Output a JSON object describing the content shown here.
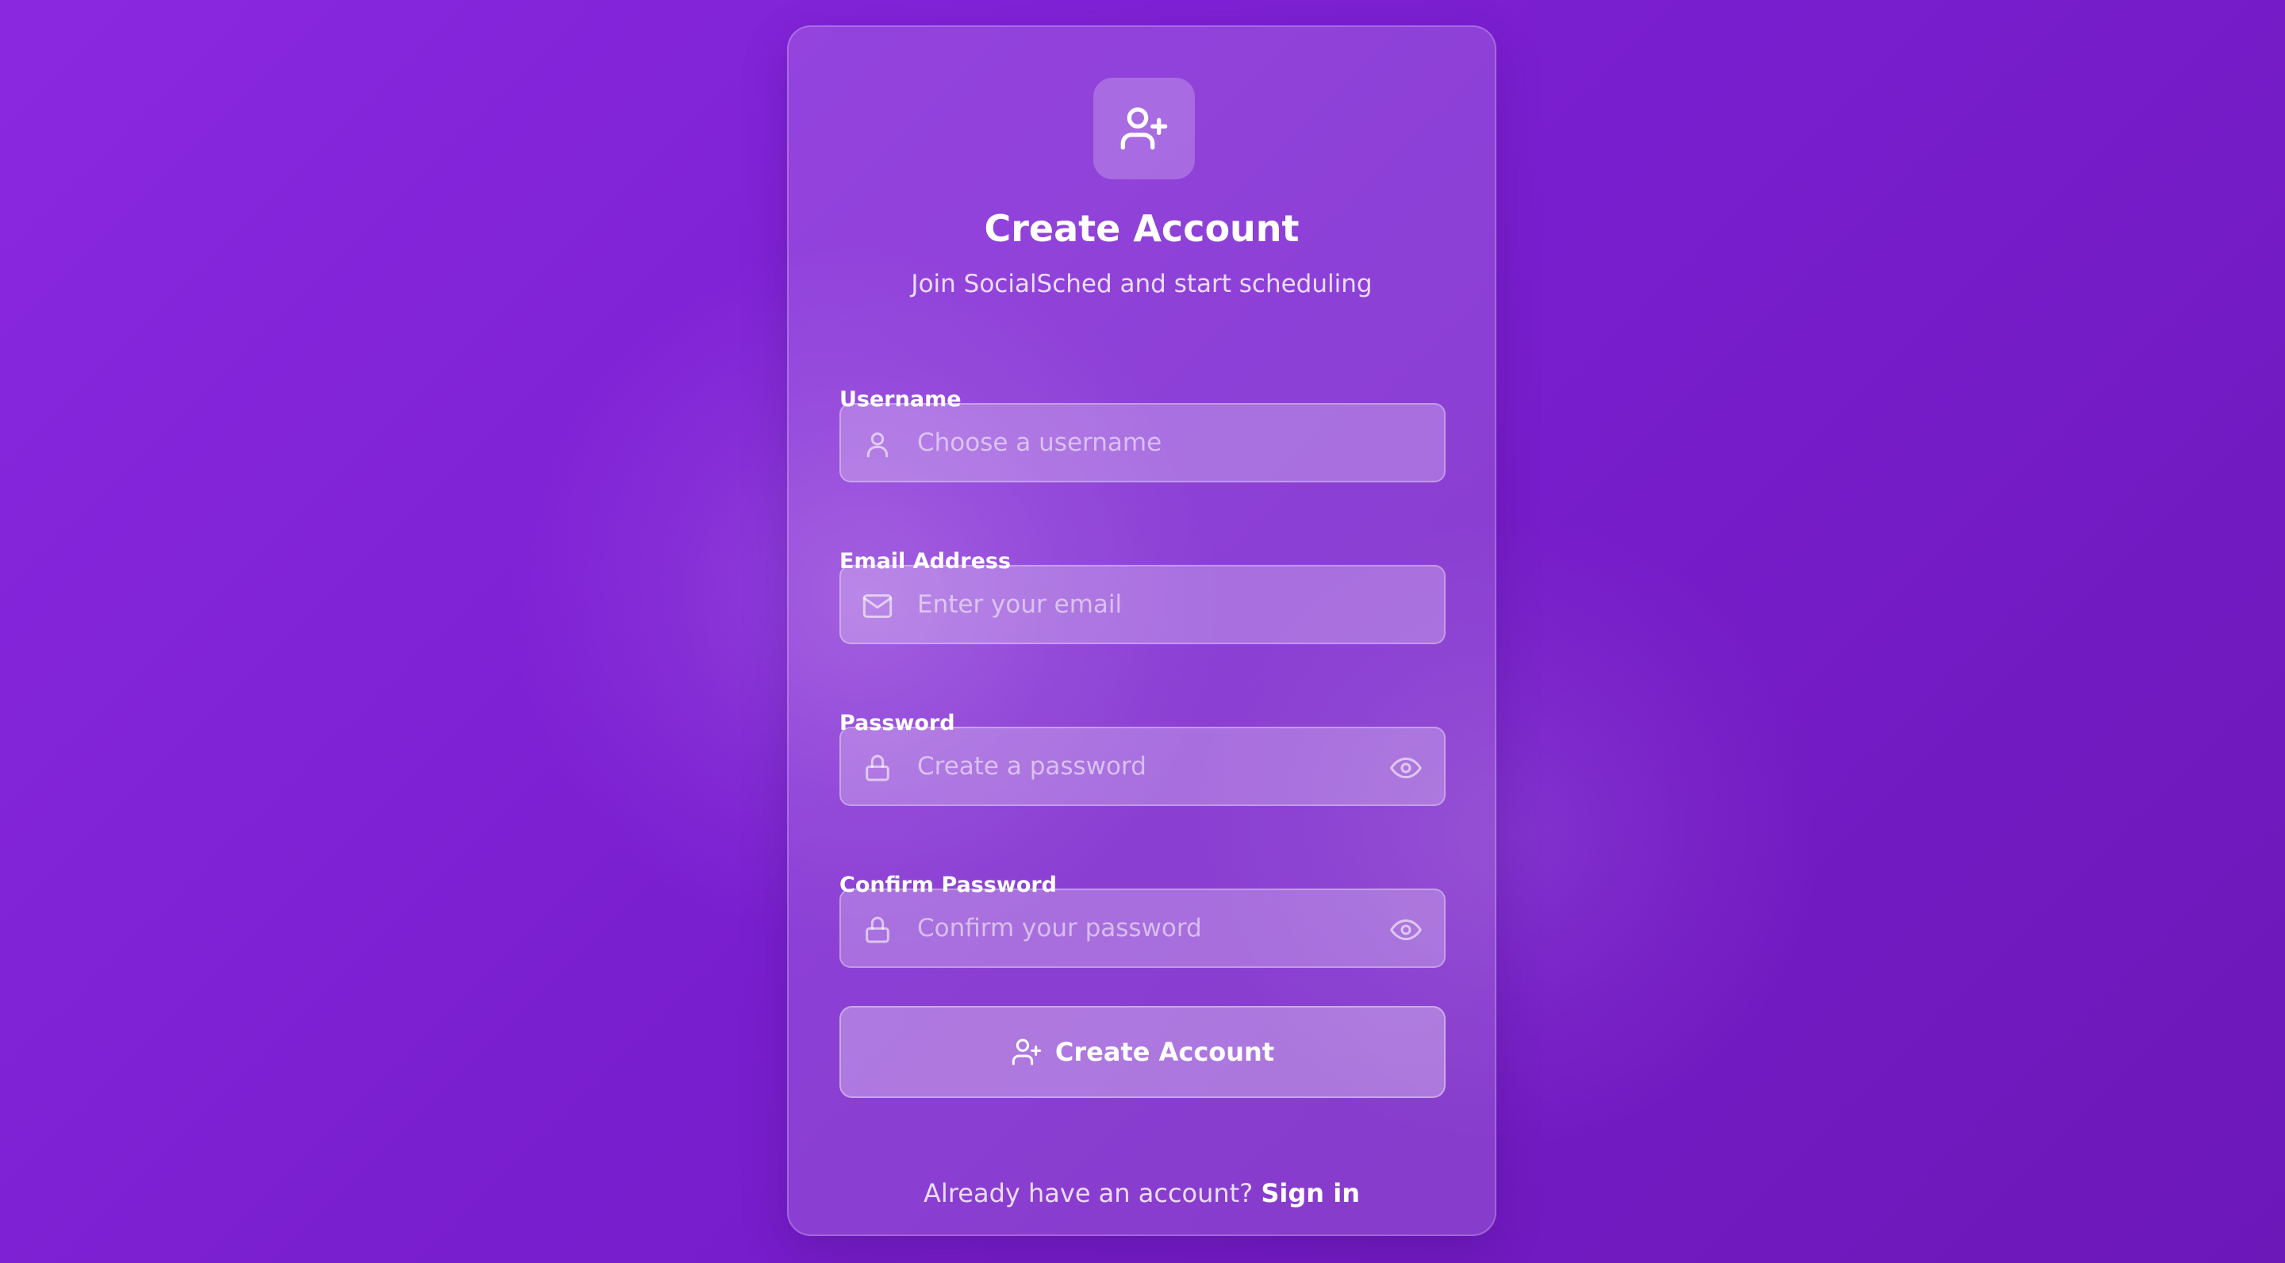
{
  "header": {
    "title": "Create Account",
    "subtitle": "Join SocialSched and start scheduling",
    "logo_icon": "user-plus-icon"
  },
  "form": {
    "username": {
      "label": "Username",
      "placeholder": "Choose a username",
      "value": "",
      "icon": "user-icon"
    },
    "email": {
      "label": "Email Address",
      "placeholder": "Enter your email",
      "value": "",
      "icon": "mail-icon"
    },
    "password": {
      "label": "Password",
      "placeholder": "Create a password",
      "value": "",
      "icon": "lock-icon",
      "toggle_icon": "eye-icon"
    },
    "confirm_password": {
      "label": "Confirm Password",
      "placeholder": "Confirm your password",
      "value": "",
      "icon": "lock-icon",
      "toggle_icon": "eye-icon"
    },
    "submit_label": "Create Account",
    "submit_icon": "user-plus-icon"
  },
  "footer": {
    "question": "Already have an account?",
    "link_label": "Sign in"
  },
  "colors": {
    "background_start": "#8a28e0",
    "background_end": "#6c17b8",
    "text": "#ffffff"
  }
}
